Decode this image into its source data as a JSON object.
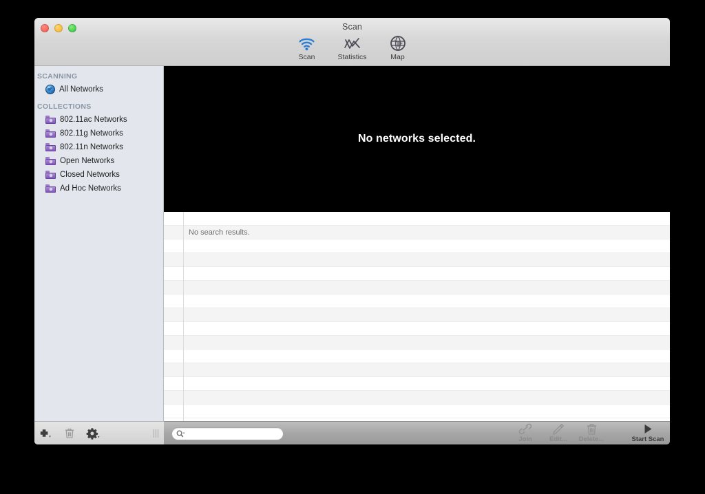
{
  "window": {
    "title": "Scan",
    "traffic_lights": [
      {
        "name": "close",
        "color": "#f2584e"
      },
      {
        "name": "minimize",
        "color": "#f5b32a"
      },
      {
        "name": "zoom",
        "color": "#29c33f"
      }
    ]
  },
  "toolbar": {
    "items": [
      {
        "label": "Scan",
        "icon": "wifi-icon",
        "selected": true
      },
      {
        "label": "Statistics",
        "icon": "line-chart-icon",
        "selected": false
      },
      {
        "label": "Map",
        "icon": "globe-icon",
        "selected": false
      }
    ]
  },
  "sidebar": {
    "sections": [
      {
        "header": "SCANNING",
        "items": [
          {
            "label": "All Networks",
            "icon": "globe-icon"
          }
        ]
      },
      {
        "header": "COLLECTIONS",
        "items": [
          {
            "label": "802.11ac Networks",
            "icon": "smart-folder-icon"
          },
          {
            "label": "802.11g Networks",
            "icon": "smart-folder-icon"
          },
          {
            "label": "802.11n Networks",
            "icon": "smart-folder-icon"
          },
          {
            "label": "Open Networks",
            "icon": "smart-folder-icon"
          },
          {
            "label": "Closed Networks",
            "icon": "smart-folder-icon"
          },
          {
            "label": "Ad Hoc Networks",
            "icon": "smart-folder-icon"
          }
        ]
      }
    ],
    "bottom_buttons": [
      {
        "name": "add",
        "icon": "plus-icon",
        "has_menu": true
      },
      {
        "name": "delete",
        "icon": "trash-icon",
        "has_menu": false
      },
      {
        "name": "settings",
        "icon": "gear-icon",
        "has_menu": true
      }
    ],
    "resize_grip": "grip-icon"
  },
  "main": {
    "graph_empty_message": "No networks selected.",
    "table": {
      "empty_message": "No search results.",
      "empty_message_row_index": 1,
      "row_count": 15
    }
  },
  "bottom_bar": {
    "search": {
      "value": "",
      "placeholder": "",
      "icon": "search-icon"
    },
    "actions": [
      {
        "label": "Join",
        "icon": "link-icon",
        "enabled": false
      },
      {
        "label": "Edit...",
        "icon": "pencil-icon",
        "enabled": false
      },
      {
        "label": "Delete...",
        "icon": "trash-icon",
        "enabled": false
      },
      {
        "label": "Start Scan",
        "icon": "play-icon",
        "enabled": true
      }
    ]
  },
  "colors": {
    "accent_blue": "#2a7fd4",
    "sidebar_bg": "#e3e7ed",
    "graph_bg": "#000000",
    "folder_purple": "#8158b8"
  }
}
